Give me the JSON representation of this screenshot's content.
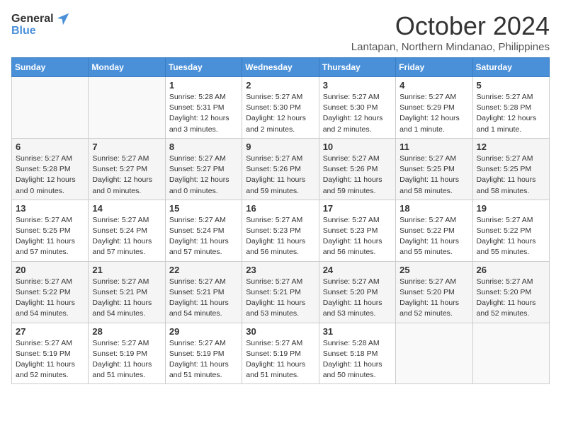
{
  "logo": {
    "text_general": "General",
    "text_blue": "Blue"
  },
  "header": {
    "month": "October 2024",
    "location": "Lantapan, Northern Mindanao, Philippines"
  },
  "weekdays": [
    "Sunday",
    "Monday",
    "Tuesday",
    "Wednesday",
    "Thursday",
    "Friday",
    "Saturday"
  ],
  "weeks": [
    [
      {
        "day": "",
        "info": ""
      },
      {
        "day": "",
        "info": ""
      },
      {
        "day": "1",
        "info": "Sunrise: 5:28 AM\nSunset: 5:31 PM\nDaylight: 12 hours and 3 minutes."
      },
      {
        "day": "2",
        "info": "Sunrise: 5:27 AM\nSunset: 5:30 PM\nDaylight: 12 hours and 2 minutes."
      },
      {
        "day": "3",
        "info": "Sunrise: 5:27 AM\nSunset: 5:30 PM\nDaylight: 12 hours and 2 minutes."
      },
      {
        "day": "4",
        "info": "Sunrise: 5:27 AM\nSunset: 5:29 PM\nDaylight: 12 hours and 1 minute."
      },
      {
        "day": "5",
        "info": "Sunrise: 5:27 AM\nSunset: 5:28 PM\nDaylight: 12 hours and 1 minute."
      }
    ],
    [
      {
        "day": "6",
        "info": "Sunrise: 5:27 AM\nSunset: 5:28 PM\nDaylight: 12 hours and 0 minutes."
      },
      {
        "day": "7",
        "info": "Sunrise: 5:27 AM\nSunset: 5:27 PM\nDaylight: 12 hours and 0 minutes."
      },
      {
        "day": "8",
        "info": "Sunrise: 5:27 AM\nSunset: 5:27 PM\nDaylight: 12 hours and 0 minutes."
      },
      {
        "day": "9",
        "info": "Sunrise: 5:27 AM\nSunset: 5:26 PM\nDaylight: 11 hours and 59 minutes."
      },
      {
        "day": "10",
        "info": "Sunrise: 5:27 AM\nSunset: 5:26 PM\nDaylight: 11 hours and 59 minutes."
      },
      {
        "day": "11",
        "info": "Sunrise: 5:27 AM\nSunset: 5:25 PM\nDaylight: 11 hours and 58 minutes."
      },
      {
        "day": "12",
        "info": "Sunrise: 5:27 AM\nSunset: 5:25 PM\nDaylight: 11 hours and 58 minutes."
      }
    ],
    [
      {
        "day": "13",
        "info": "Sunrise: 5:27 AM\nSunset: 5:25 PM\nDaylight: 11 hours and 57 minutes."
      },
      {
        "day": "14",
        "info": "Sunrise: 5:27 AM\nSunset: 5:24 PM\nDaylight: 11 hours and 57 minutes."
      },
      {
        "day": "15",
        "info": "Sunrise: 5:27 AM\nSunset: 5:24 PM\nDaylight: 11 hours and 57 minutes."
      },
      {
        "day": "16",
        "info": "Sunrise: 5:27 AM\nSunset: 5:23 PM\nDaylight: 11 hours and 56 minutes."
      },
      {
        "day": "17",
        "info": "Sunrise: 5:27 AM\nSunset: 5:23 PM\nDaylight: 11 hours and 56 minutes."
      },
      {
        "day": "18",
        "info": "Sunrise: 5:27 AM\nSunset: 5:22 PM\nDaylight: 11 hours and 55 minutes."
      },
      {
        "day": "19",
        "info": "Sunrise: 5:27 AM\nSunset: 5:22 PM\nDaylight: 11 hours and 55 minutes."
      }
    ],
    [
      {
        "day": "20",
        "info": "Sunrise: 5:27 AM\nSunset: 5:22 PM\nDaylight: 11 hours and 54 minutes."
      },
      {
        "day": "21",
        "info": "Sunrise: 5:27 AM\nSunset: 5:21 PM\nDaylight: 11 hours and 54 minutes."
      },
      {
        "day": "22",
        "info": "Sunrise: 5:27 AM\nSunset: 5:21 PM\nDaylight: 11 hours and 54 minutes."
      },
      {
        "day": "23",
        "info": "Sunrise: 5:27 AM\nSunset: 5:21 PM\nDaylight: 11 hours and 53 minutes."
      },
      {
        "day": "24",
        "info": "Sunrise: 5:27 AM\nSunset: 5:20 PM\nDaylight: 11 hours and 53 minutes."
      },
      {
        "day": "25",
        "info": "Sunrise: 5:27 AM\nSunset: 5:20 PM\nDaylight: 11 hours and 52 minutes."
      },
      {
        "day": "26",
        "info": "Sunrise: 5:27 AM\nSunset: 5:20 PM\nDaylight: 11 hours and 52 minutes."
      }
    ],
    [
      {
        "day": "27",
        "info": "Sunrise: 5:27 AM\nSunset: 5:19 PM\nDaylight: 11 hours and 52 minutes."
      },
      {
        "day": "28",
        "info": "Sunrise: 5:27 AM\nSunset: 5:19 PM\nDaylight: 11 hours and 51 minutes."
      },
      {
        "day": "29",
        "info": "Sunrise: 5:27 AM\nSunset: 5:19 PM\nDaylight: 11 hours and 51 minutes."
      },
      {
        "day": "30",
        "info": "Sunrise: 5:27 AM\nSunset: 5:19 PM\nDaylight: 11 hours and 51 minutes."
      },
      {
        "day": "31",
        "info": "Sunrise: 5:28 AM\nSunset: 5:18 PM\nDaylight: 11 hours and 50 minutes."
      },
      {
        "day": "",
        "info": ""
      },
      {
        "day": "",
        "info": ""
      }
    ]
  ]
}
